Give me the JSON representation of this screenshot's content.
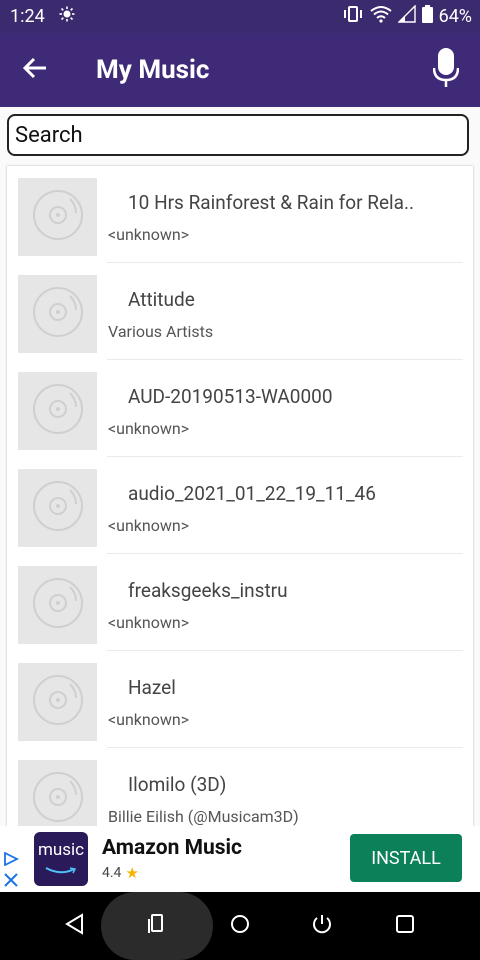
{
  "status_bar": {
    "time": "1:24",
    "battery": "64%",
    "icons": [
      "brightness-icon",
      "vibrate-icon",
      "wifi-icon",
      "signal-icon",
      "battery-icon"
    ]
  },
  "app_bar": {
    "title": "My Music",
    "back_icon": "arrow-left-icon",
    "mic_icon": "microphone-icon",
    "background": "#3f2a77"
  },
  "search": {
    "placeholder": "Search"
  },
  "songs": [
    {
      "title": "10 Hrs Rainforest & Rain for Rela..",
      "artist": "<unknown>"
    },
    {
      "title": "Attitude",
      "artist": "Various Artists"
    },
    {
      "title": "AUD-20190513-WA0000",
      "artist": "<unknown>"
    },
    {
      "title": "audio_2021_01_22_19_11_46",
      "artist": "<unknown>"
    },
    {
      "title": "freaksgeeks_instru",
      "artist": "<unknown>"
    },
    {
      "title": "Hazel",
      "artist": "<unknown>"
    },
    {
      "title": "Ilomilo (3D)",
      "artist": "Billie Eilish (@Musicam3D)"
    }
  ],
  "ad": {
    "logo_text": "music",
    "title": "Amazon Music",
    "rating": "4.4",
    "install_label": "INSTALL",
    "install_color": "#0c8059"
  },
  "nav_bar": {
    "icons": [
      "back-triangle-icon",
      "recents-apps-icon",
      "home-circle-icon",
      "power-icon",
      "overview-square-icon"
    ]
  }
}
